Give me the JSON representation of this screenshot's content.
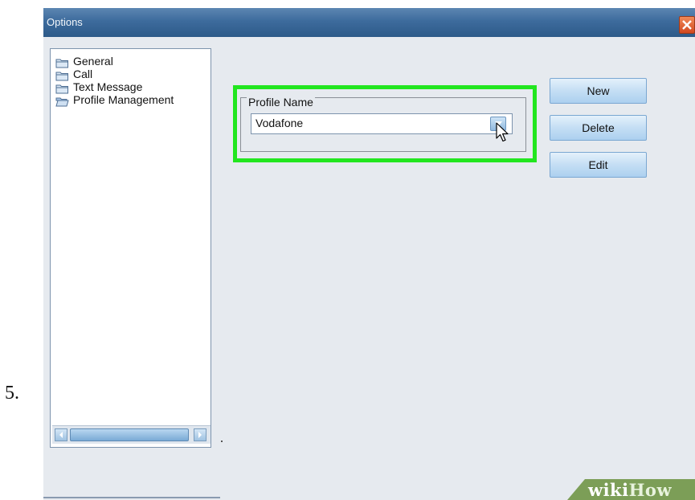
{
  "step_number": "5.",
  "window": {
    "title": "Options"
  },
  "tree": {
    "items": [
      {
        "label": "General",
        "icon": "folder-icon"
      },
      {
        "label": "Call",
        "icon": "folder-icon"
      },
      {
        "label": "Text Message",
        "icon": "folder-icon"
      },
      {
        "label": "Profile Management",
        "icon": "folder-open-icon"
      }
    ]
  },
  "profile": {
    "group_label": "Profile Name",
    "selected_value": "Vodafone"
  },
  "buttons": {
    "new_label": "New",
    "delete_label": "Delete",
    "edit_label": "Edit"
  },
  "watermark": {
    "wiki": "wiki",
    "how": "How"
  },
  "colors": {
    "highlight": "#22e61f",
    "titlebar": "#3d6b9c",
    "button": "#c4def4",
    "watermark": "#7c9e57"
  }
}
